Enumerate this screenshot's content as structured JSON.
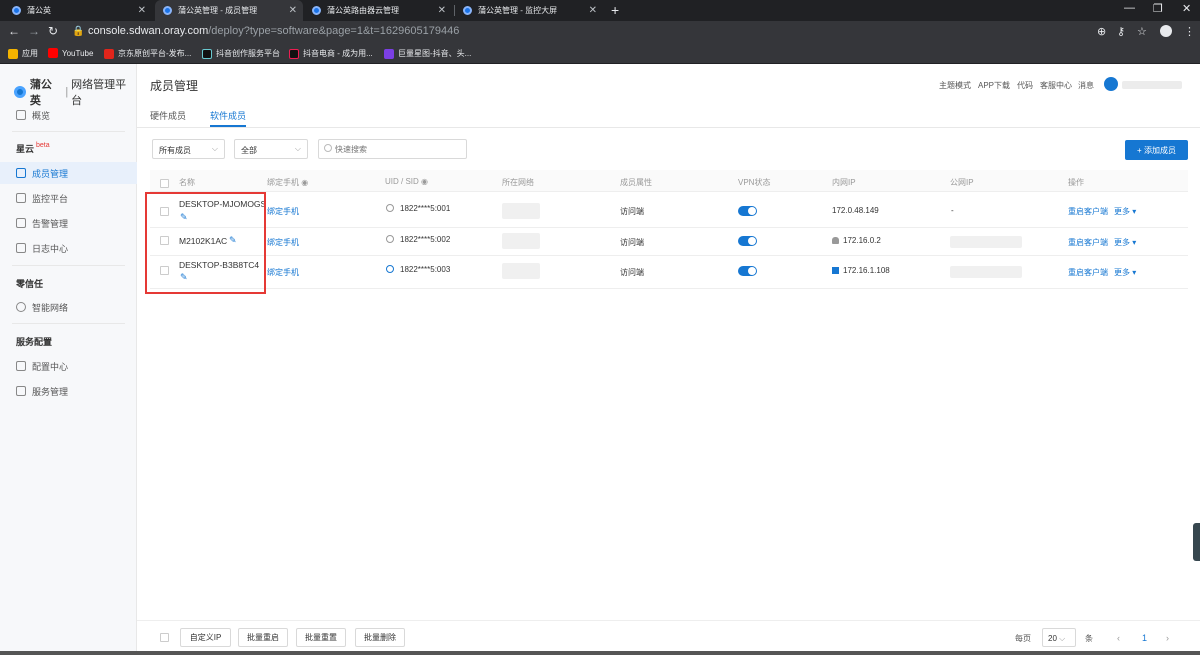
{
  "browser": {
    "tabs": [
      {
        "title": "蒲公英"
      },
      {
        "title": "蒲公英管理 - 成员管理"
      },
      {
        "title": "蒲公英路由器云管理"
      },
      {
        "title": "蒲公英管理 - 监控大屏"
      }
    ],
    "url_main": "console.sdwan.oray.com",
    "url_rest": "/deploy?type=software&page=1&t=1629605179446",
    "bookmarks": [
      "应用",
      "YouTube",
      "京东原创平台-发布...",
      "抖音创作服务平台",
      "抖音电商 - 成为用...",
      "巨量星图-抖音、头..."
    ]
  },
  "app": {
    "logo_brand": "蒲公英",
    "logo_product": "网络管理平台",
    "sidebar": {
      "overview": "概览",
      "group_xingyun": "星云",
      "beta": "beta",
      "members": "成员管理",
      "monitor": "监控平台",
      "alerts": "告警管理",
      "logs": "日志中心",
      "group_zero_trust": "零信任",
      "smart_network": "智能网络",
      "group_service": "服务配置",
      "config_center": "配置中心",
      "service_mgmt": "服务管理"
    },
    "header": {
      "title": "成员管理",
      "links": [
        "主题模式",
        "APP下载",
        "代码",
        "客服中心",
        "消息"
      ]
    },
    "tabs": [
      "硬件成员",
      "软件成员"
    ],
    "filters": {
      "member_select": "所有成员",
      "status_select": "全部",
      "search_placeholder": "快速搜索",
      "add_button": "+ 添加成员"
    },
    "table": {
      "headers": [
        "名称",
        "绑定手机",
        "UID / SID",
        "所在网络",
        "成员属性",
        "VPN状态",
        "内网IP",
        "公网IP",
        "操作"
      ],
      "rows": [
        {
          "name": "DESKTOP-MJOMOGS",
          "phone": "绑定手机",
          "uid": "1822****5:001",
          "attr": "访问端",
          "vpn": true,
          "lan_ip": "172.0.48.149",
          "os": "",
          "public_ip": "-",
          "action": "重启客户端",
          "more": "更多"
        },
        {
          "name": "M2102K1AC",
          "phone": "绑定手机",
          "uid": "1822****5:002",
          "attr": "访问端",
          "vpn": true,
          "lan_ip": "172.16.0.2",
          "os": "android",
          "public_ip": "",
          "action": "重启客户端",
          "more": "更多"
        },
        {
          "name": "DESKTOP-B3B8TC4",
          "phone": "绑定手机",
          "uid": "1822****5:003",
          "attr": "访问端",
          "vpn": true,
          "lan_ip": "172.16.1.108",
          "os": "windows",
          "public_ip": "",
          "action": "重启客户端",
          "more": "更多"
        }
      ]
    },
    "footer": {
      "buttons": [
        "自定义IP",
        "批量重启",
        "批量重置",
        "批量删除"
      ],
      "per_page_label": "每页",
      "per_page_value": "20",
      "per_page_unit": "条",
      "current_page": "1"
    }
  },
  "colors": {
    "accent": "#1677d2",
    "highlight": "#e53935"
  }
}
